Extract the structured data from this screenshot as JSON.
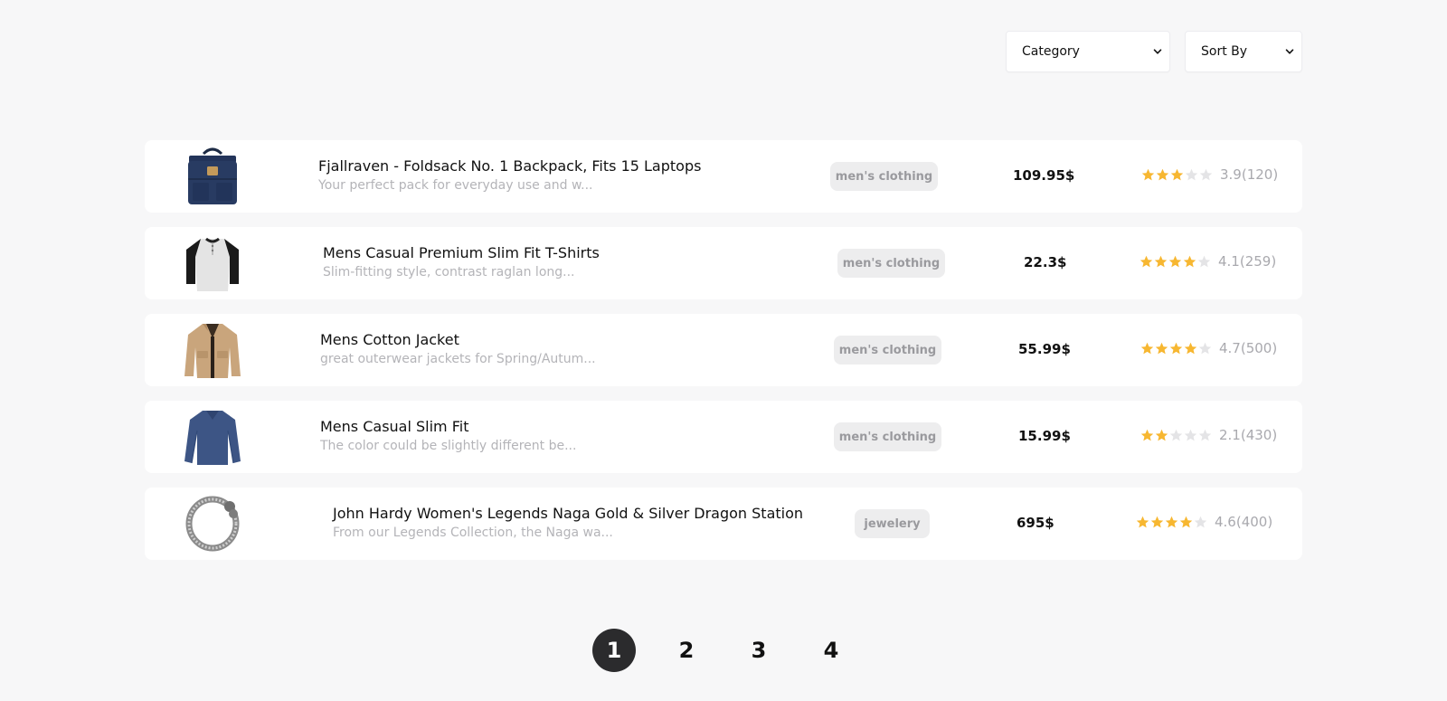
{
  "filters": {
    "category_label": "Category",
    "sort_label": "Sort By"
  },
  "products": [
    {
      "title": "Fjallraven - Foldsack No. 1 Backpack, Fits 15 Laptops",
      "description": "Your perfect pack for everyday use and w...",
      "category": "men's clothing",
      "price": "109.95$",
      "rating_value": 3.9,
      "rating_text": "3.9(120)",
      "image": "backpack-image"
    },
    {
      "title": "Mens Casual Premium Slim Fit T-Shirts",
      "description": "Slim-fitting style, contrast raglan long...",
      "category": "men's clothing",
      "price": "22.3$",
      "rating_value": 4.1,
      "rating_text": "4.1(259)",
      "image": "tshirt-image"
    },
    {
      "title": "Mens Cotton Jacket",
      "description": "great outerwear jackets for Spring/Autum...",
      "category": "men's clothing",
      "price": "55.99$",
      "rating_value": 4.7,
      "rating_text": "4.7(500)",
      "image": "jacket-image"
    },
    {
      "title": "Mens Casual Slim Fit",
      "description": "The color could be slightly different be...",
      "category": "men's clothing",
      "price": "15.99$",
      "rating_value": 2.1,
      "rating_text": "2.1(430)",
      "image": "longsleeve-image"
    },
    {
      "title": "John Hardy Women's Legends Naga Gold & Silver Dragon Station",
      "description": "From our Legends Collection, the Naga wa...",
      "category": "jewelery",
      "price": "695$",
      "rating_value": 4.6,
      "rating_text": "4.6(400)",
      "image": "bracelet-image"
    }
  ],
  "pagination": {
    "pages": [
      "1",
      "2",
      "3",
      "4"
    ],
    "current": "1"
  },
  "colors": {
    "background": "#f7f7f8",
    "star_filled": "#f7b731",
    "star_empty": "#e4e4e6",
    "badge_bg": "#ededee",
    "badge_text": "#9a9a9e",
    "active_page": "#2b2b2d"
  },
  "icons": {
    "filter_chevron": "chevron-down-icon",
    "rating": "star-icon"
  }
}
